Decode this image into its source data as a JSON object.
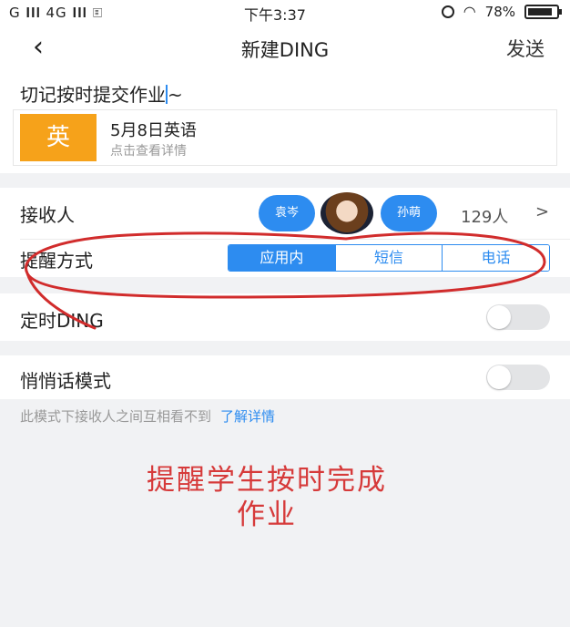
{
  "status_bar": {
    "left": "G 𝐈𝐈𝐥 4G 𝐈𝐈𝐥 🗉",
    "time": "下午3:37",
    "battery_percent": "78%"
  },
  "nav": {
    "title": "新建DING",
    "send_label": "发送"
  },
  "message": {
    "text": "切记按时提交作业",
    "tail": "~"
  },
  "attachment": {
    "badge": "英",
    "title": "5月8日英语",
    "subtitle": "点击查看详情"
  },
  "recipients": {
    "label": "接收人",
    "avatars": [
      "袁岑",
      "孙萌"
    ],
    "count": "129人",
    "chevron": ">"
  },
  "reminder": {
    "label": "提醒方式",
    "options": [
      "应用内",
      "短信",
      "电话"
    ],
    "selected": "应用内"
  },
  "timer": {
    "label": "定时DING",
    "enabled": false
  },
  "whisper": {
    "label": "悄悄话模式",
    "enabled": false,
    "hint": "此模式下接收人之间互相看不到",
    "hint_link": "了解详情"
  },
  "annotation": {
    "line1": "提醒学生按时完成",
    "line2": "作业"
  },
  "colors": {
    "accent": "#2d8cf0",
    "badge": "#f6a21a",
    "annotation": "#d63a3a"
  }
}
